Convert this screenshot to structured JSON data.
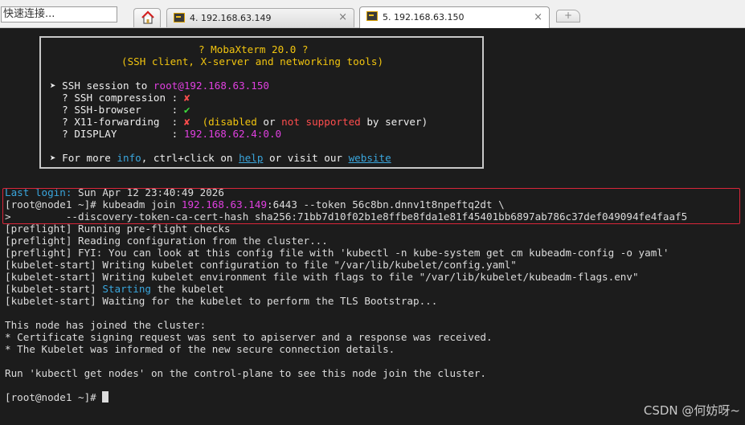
{
  "quick_connect": {
    "placeholder": "快速连接..."
  },
  "tabs": [
    {
      "label": "4. 192.168.63.149",
      "close": "×"
    },
    {
      "label": "5. 192.168.63.150",
      "close": "×"
    }
  ],
  "new_tab": "+",
  "banner": {
    "title": "? MobaXterm 20.0 ?",
    "subtitle": "(SSH client, X-server and networking tools)",
    "ssh_prefix": "➤ SSH session to ",
    "ssh_user": "root",
    "ssh_host": "@192.168.63.150",
    "compression_label": "  ? SSH compression : ",
    "compression_val": "✘",
    "browser_label": "  ? SSH-browser     : ",
    "browser_val": "✔",
    "x11_label": "  ? X11-forwarding  : ",
    "x11_val": "✘",
    "x11_p1": "  (",
    "x11_disabled": "disabled",
    "x11_or": " or ",
    "x11_notsupported": "not supported",
    "x11_tail": " by server)",
    "display_label": "  ? DISPLAY         : ",
    "display_val": "192.168.62.4:0.0",
    "more_prefix": "➤ For more ",
    "more_info": "info",
    "more_mid": ", ctrl+click on ",
    "more_help": "help",
    "more_mid2": " or visit our ",
    "more_website": "website"
  },
  "terminal": {
    "last_login_label": "Last login:",
    "last_login_val": " Sun Apr 12 23:40:49 2026",
    "join_prompt": "[root@node1 ~]# kubeadm join ",
    "join_ip": "192.168.63.149",
    "join_rest": ":6443 --token 56c8bn.dnnv1t8npeftq2dt \\",
    "join_cont": ">         --discovery-token-ca-cert-hash sha256:71bb7d10f02b1e8ffbe8fda1e81f45401bb6897ab786c37def049094fe4faaf5",
    "l1": "[preflight] Running pre-flight checks",
    "l2": "[preflight] Reading configuration from the cluster...",
    "l3": "[preflight] FYI: You can look at this config file with 'kubectl -n kube-system get cm kubeadm-config -o yaml'",
    "l4": "[kubelet-start] Writing kubelet configuration to file \"/var/lib/kubelet/config.yaml\"",
    "l5": "[kubelet-start] Writing kubelet environment file with flags to file \"/var/lib/kubelet/kubeadm-flags.env\"",
    "l6_prefix": "[kubelet-start] ",
    "l6_starting": "Starting",
    "l6_rest": " the kubelet",
    "l7": "[kubelet-start] Waiting for the kubelet to perform the TLS Bootstrap...",
    "l8": "This node has joined the cluster:",
    "l9": "* Certificate signing request was sent to apiserver and a response was received.",
    "l10": "* The Kubelet was informed of the new secure connection details.",
    "l11": "Run 'kubectl get nodes' on the control-plane to see this node join the cluster.",
    "final_prompt": "[root@node1 ~]# "
  },
  "watermark": "CSDN @何妨呀~"
}
